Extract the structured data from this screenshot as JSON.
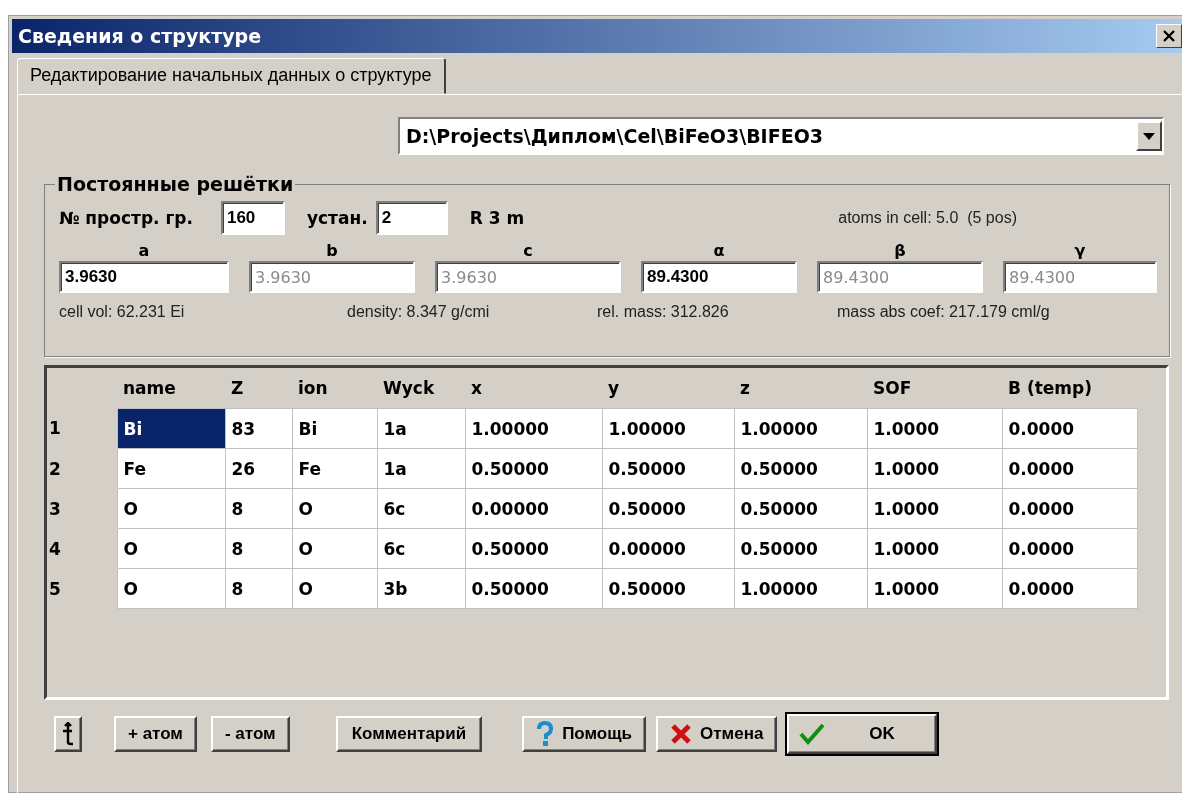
{
  "window": {
    "title": "Сведения о структуре"
  },
  "tabs": [
    {
      "label": "Редактирование начальных данных о структуре",
      "selected": true
    }
  ],
  "file_path": {
    "value": "D:\\Projects\\Диплом\\Cel\\BiFeO3\\BIFEO3"
  },
  "lattice": {
    "title": "Постоянные решётки",
    "space_group_label": "№ простр. гр.",
    "space_group": "160",
    "setting_label": "устан.",
    "setting": "2",
    "symbol": "R 3 m",
    "atoms_info": "atoms in cell: 5.0  (5 pos)",
    "params": [
      {
        "label": "a",
        "value": "3.9630",
        "disabled": false
      },
      {
        "label": "b",
        "value": "3.9630",
        "disabled": true
      },
      {
        "label": "c",
        "value": "3.9630",
        "disabled": true
      },
      {
        "label": "α",
        "value": "89.4300",
        "disabled": false
      },
      {
        "label": "β",
        "value": "89.4300",
        "disabled": true
      },
      {
        "label": "γ",
        "value": "89.4300",
        "disabled": true
      }
    ],
    "stats": [
      "cell vol: 62.231 Ei",
      "density: 8.347 g/cmi",
      "rel. mass: 312.826",
      "mass abs coef: 217.179 cml/g"
    ]
  },
  "table": {
    "columns": [
      "name",
      "Z",
      "ion",
      "Wyck",
      "x",
      "y",
      "z",
      "SOF",
      "B (temp)"
    ],
    "rows": [
      {
        "number": "1",
        "cells": [
          {
            "text": "Bi",
            "selected": true
          },
          {
            "text": "83",
            "selected": false
          },
          {
            "text": "Bi",
            "selected": false
          },
          {
            "text": "1a",
            "selected": false
          },
          {
            "text": "1.00000",
            "selected": false
          },
          {
            "text": "1.00000",
            "selected": false
          },
          {
            "text": "1.00000",
            "selected": false
          },
          {
            "text": "1.0000",
            "selected": false
          },
          {
            "text": "0.0000",
            "selected": false
          }
        ]
      },
      {
        "number": "2",
        "cells": [
          {
            "text": "Fe",
            "selected": false
          },
          {
            "text": "26",
            "selected": false
          },
          {
            "text": "Fe",
            "selected": false
          },
          {
            "text": "1a",
            "selected": false
          },
          {
            "text": "0.50000",
            "selected": false
          },
          {
            "text": "0.50000",
            "selected": false
          },
          {
            "text": "0.50000",
            "selected": false
          },
          {
            "text": "1.0000",
            "selected": false
          },
          {
            "text": "0.0000",
            "selected": false
          }
        ]
      },
      {
        "number": "3",
        "cells": [
          {
            "text": "O",
            "selected": false
          },
          {
            "text": "8",
            "selected": false
          },
          {
            "text": "O",
            "selected": false
          },
          {
            "text": "6c",
            "selected": false
          },
          {
            "text": "0.00000",
            "selected": false
          },
          {
            "text": "0.50000",
            "selected": false
          },
          {
            "text": "0.50000",
            "selected": false
          },
          {
            "text": "1.0000",
            "selected": false
          },
          {
            "text": "0.0000",
            "selected": false
          }
        ]
      },
      {
        "number": "4",
        "cells": [
          {
            "text": "O",
            "selected": false
          },
          {
            "text": "8",
            "selected": false
          },
          {
            "text": "O",
            "selected": false
          },
          {
            "text": "6c",
            "selected": false
          },
          {
            "text": "0.50000",
            "selected": false
          },
          {
            "text": "0.00000",
            "selected": false
          },
          {
            "text": "0.50000",
            "selected": false
          },
          {
            "text": "1.0000",
            "selected": false
          },
          {
            "text": "0.0000",
            "selected": false
          }
        ]
      },
      {
        "number": "5",
        "cells": [
          {
            "text": "O",
            "selected": false
          },
          {
            "text": "8",
            "selected": false
          },
          {
            "text": "O",
            "selected": false
          },
          {
            "text": "3b",
            "selected": false
          },
          {
            "text": "0.50000",
            "selected": false
          },
          {
            "text": "0.50000",
            "selected": false
          },
          {
            "text": "1.00000",
            "selected": false
          },
          {
            "text": "1.0000",
            "selected": false
          },
          {
            "text": "0.0000",
            "selected": false
          }
        ]
      }
    ]
  },
  "buttons": [
    {
      "kind": "transpose"
    },
    {
      "kind": "text",
      "label": "+ атом"
    },
    {
      "kind": "text",
      "label": "- атом"
    },
    {
      "kind": "text",
      "label": "Комментарий"
    },
    {
      "kind": "help",
      "label": "Помощь"
    },
    {
      "kind": "cancel",
      "label": "Отмена"
    },
    {
      "kind": "ok",
      "label": "OK",
      "default": true
    }
  ]
}
